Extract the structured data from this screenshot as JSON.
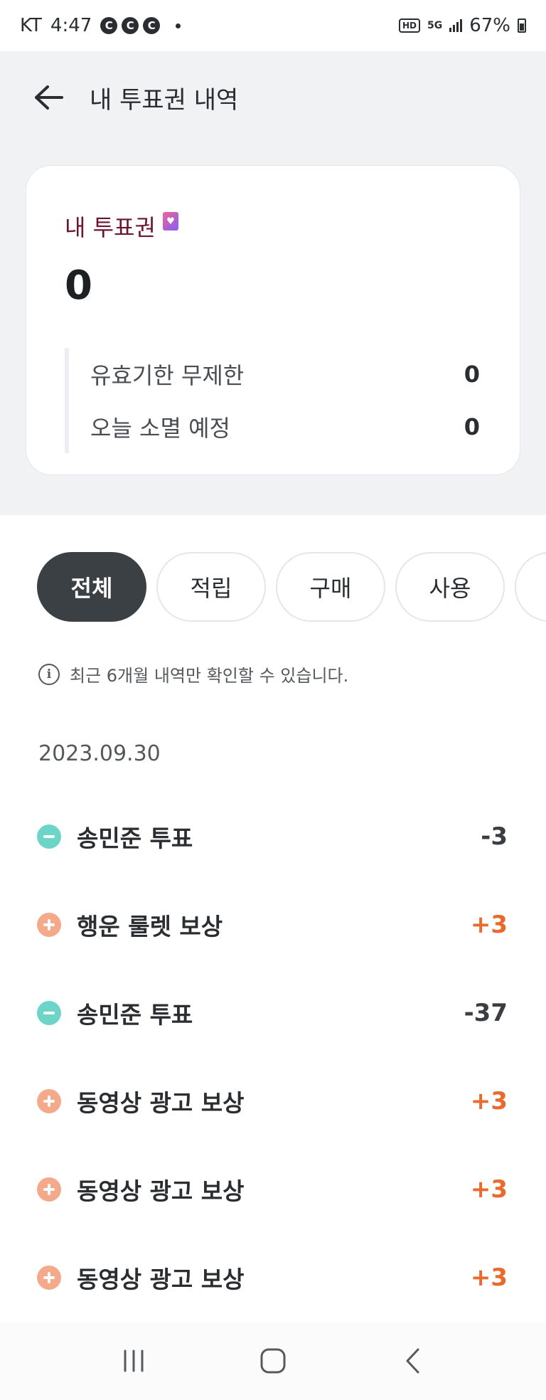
{
  "status_bar": {
    "carrier": "KT",
    "time": "4:47",
    "notifications": [
      "C",
      "C",
      "C"
    ],
    "hd": "HD",
    "network": "5G",
    "battery": "67%"
  },
  "header": {
    "title": "내 투표권 내역"
  },
  "summary": {
    "title": "내 투표권",
    "total": "0",
    "rows": [
      {
        "label": "유효기한 무제한",
        "value": "0"
      },
      {
        "label": "오늘 소멸 예정",
        "value": "0"
      }
    ]
  },
  "tabs": [
    {
      "label": "전체",
      "active": true
    },
    {
      "label": "적립",
      "active": false
    },
    {
      "label": "구매",
      "active": false
    },
    {
      "label": "사용",
      "active": false
    },
    {
      "label": "",
      "active": false
    }
  ],
  "notice": "최근 6개월 내역만 확인할 수 있습니다.",
  "history": {
    "date": "2023.09.30",
    "items": [
      {
        "type": "minus",
        "label": "송민준 투표",
        "amount": "-3"
      },
      {
        "type": "plus",
        "label": "행운 룰렛 보상",
        "amount": "+3"
      },
      {
        "type": "minus",
        "label": "송민준 투표",
        "amount": "-37"
      },
      {
        "type": "plus",
        "label": "동영상 광고 보상",
        "amount": "+3"
      },
      {
        "type": "plus",
        "label": "동영상 광고 보상",
        "amount": "+3"
      },
      {
        "type": "plus",
        "label": "동영상 광고 보상",
        "amount": "+3"
      }
    ]
  },
  "colors": {
    "accent_positive": "#e86a2c",
    "minus_badge": "#6dd5c8",
    "plus_badge": "#f4a98a",
    "active_tab": "#3a4043",
    "card_title": "#6b1530"
  },
  "icons": {
    "back": "arrow-left-icon",
    "ticket": "ticket-heart-icon",
    "info": "info-icon",
    "minus": "minus-circle-icon",
    "plus": "plus-circle-icon",
    "nav_recent": "recent-apps-icon",
    "nav_home": "home-icon",
    "nav_back": "nav-back-icon"
  }
}
